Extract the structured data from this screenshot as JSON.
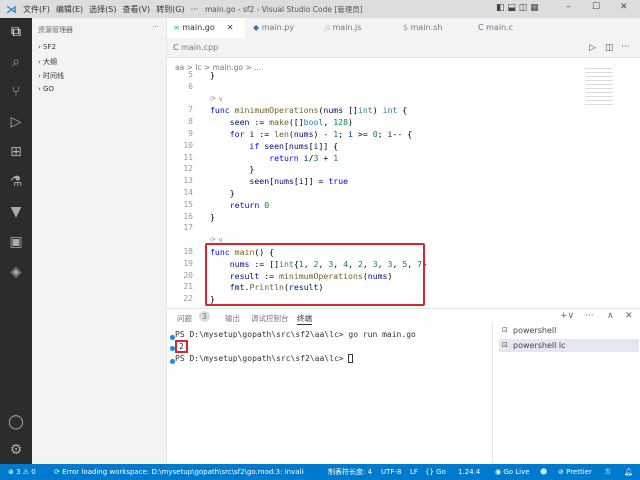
{
  "titlebar": {
    "menus": [
      "文件(F)",
      "编辑(E)",
      "选择(S)",
      "查看(V)",
      "转到(G)",
      "···"
    ],
    "title": "main.go - sf2 - Visual Studio Code [管理员]"
  },
  "sidebar": {
    "header": "资源管理器",
    "more": "···",
    "sections": [
      "SF2",
      "大纲",
      "时间线",
      "GO"
    ]
  },
  "tabs": [
    {
      "label": "main.go",
      "icon": "go-icon",
      "active": true
    },
    {
      "label": "main.py",
      "icon": "python-icon"
    },
    {
      "label": "main.js",
      "icon": "js-icon"
    },
    {
      "label": "main.sh",
      "icon": "shell-icon"
    },
    {
      "label": "main.c",
      "icon": "c-icon"
    },
    {
      "label": "main.cpp",
      "icon": "cpp-icon"
    }
  ],
  "breadcrumb": "aa > lc > main.go > ...",
  "editor": {
    "codelens": "⟳ ∨",
    "lines": [
      {
        "n": "5",
        "t": [
          [
            "}",
            "pl"
          ]
        ]
      },
      {
        "n": "6",
        "t": []
      },
      {
        "lens": true
      },
      {
        "n": "7",
        "t": [
          [
            "func ",
            "kw"
          ],
          [
            "minimumOperations",
            "fn"
          ],
          [
            "(",
            "pl"
          ],
          [
            "nums ",
            "vr"
          ],
          [
            "[]",
            "pl"
          ],
          [
            "int",
            "ty"
          ],
          [
            ") ",
            "pl"
          ],
          [
            "int",
            "ty"
          ],
          [
            " {",
            "pl"
          ]
        ]
      },
      {
        "n": "8",
        "t": [
          [
            "    seen",
            "vr"
          ],
          [
            " := ",
            "pl"
          ],
          [
            "make",
            "fn"
          ],
          [
            "([]",
            "pl"
          ],
          [
            "bool",
            "ty"
          ],
          [
            ", ",
            "pl"
          ],
          [
            "128",
            "nm"
          ],
          [
            ")",
            "pl"
          ]
        ]
      },
      {
        "n": "9",
        "t": [
          [
            "    for ",
            "kw"
          ],
          [
            "i",
            "vr"
          ],
          [
            " := ",
            "pl"
          ],
          [
            "len",
            "fn"
          ],
          [
            "(",
            "pl"
          ],
          [
            "nums",
            "vr"
          ],
          [
            ") - ",
            "pl"
          ],
          [
            "1",
            "nm"
          ],
          [
            "; ",
            "pl"
          ],
          [
            "i",
            "vr"
          ],
          [
            " >= ",
            "pl"
          ],
          [
            "0",
            "nm"
          ],
          [
            "; ",
            "pl"
          ],
          [
            "i",
            "vr"
          ],
          [
            "-- {",
            "pl"
          ]
        ]
      },
      {
        "n": "10",
        "t": [
          [
            "        if ",
            "kw"
          ],
          [
            "seen",
            "vr"
          ],
          [
            "[",
            "pl"
          ],
          [
            "nums",
            "vr"
          ],
          [
            "[",
            "pl"
          ],
          [
            "i",
            "vr"
          ],
          [
            "]] {",
            "pl"
          ]
        ]
      },
      {
        "n": "11",
        "t": [
          [
            "            return ",
            "kw"
          ],
          [
            "i",
            "vr"
          ],
          [
            "/",
            "pl"
          ],
          [
            "3",
            "nm"
          ],
          [
            " + ",
            "pl"
          ],
          [
            "1",
            "nm"
          ]
        ]
      },
      {
        "n": "12",
        "t": [
          [
            "        }",
            "pl"
          ]
        ]
      },
      {
        "n": "13",
        "t": [
          [
            "        seen",
            "vr"
          ],
          [
            "[",
            "pl"
          ],
          [
            "nums",
            "vr"
          ],
          [
            "[",
            "pl"
          ],
          [
            "i",
            "vr"
          ],
          [
            "]] = ",
            "pl"
          ],
          [
            "true",
            "kw"
          ]
        ]
      },
      {
        "n": "14",
        "t": [
          [
            "    }",
            "pl"
          ]
        ]
      },
      {
        "n": "15",
        "t": [
          [
            "    return ",
            "kw"
          ],
          [
            "0",
            "nm"
          ]
        ]
      },
      {
        "n": "16",
        "t": [
          [
            "}",
            "pl"
          ]
        ]
      },
      {
        "n": "17",
        "t": []
      },
      {
        "lens": true
      },
      {
        "n": "18",
        "t": [
          [
            "func ",
            "kw"
          ],
          [
            "main",
            "fn"
          ],
          [
            "() {",
            "pl"
          ]
        ]
      },
      {
        "n": "19",
        "t": [
          [
            "    nums",
            "vr"
          ],
          [
            " := []",
            "pl"
          ],
          [
            "int",
            "ty"
          ],
          [
            "{",
            "pl"
          ],
          [
            "1",
            "nm"
          ],
          [
            ", ",
            "pl"
          ],
          [
            "2",
            "nm"
          ],
          [
            ", ",
            "pl"
          ],
          [
            "3",
            "nm"
          ],
          [
            ", ",
            "pl"
          ],
          [
            "4",
            "nm"
          ],
          [
            ", ",
            "pl"
          ],
          [
            "2",
            "nm"
          ],
          [
            ", ",
            "pl"
          ],
          [
            "3",
            "nm"
          ],
          [
            ", ",
            "pl"
          ],
          [
            "3",
            "nm"
          ],
          [
            ", ",
            "pl"
          ],
          [
            "5",
            "nm"
          ],
          [
            ", ",
            "pl"
          ],
          [
            "7",
            "nm"
          ],
          [
            "}",
            "pl"
          ]
        ]
      },
      {
        "n": "20",
        "t": [
          [
            "    result",
            "vr"
          ],
          [
            " := ",
            "pl"
          ],
          [
            "minimumOperations",
            "fn"
          ],
          [
            "(",
            "pl"
          ],
          [
            "nums",
            "vr"
          ],
          [
            ")",
            "pl"
          ]
        ]
      },
      {
        "n": "21",
        "t": [
          [
            "    fmt",
            "vr"
          ],
          [
            ".",
            "pl"
          ],
          [
            "Println",
            "fn"
          ],
          [
            "(",
            "pl"
          ],
          [
            "result",
            "vr"
          ],
          [
            ")",
            "pl"
          ]
        ]
      },
      {
        "n": "22",
        "t": [
          [
            "}",
            "pl"
          ]
        ]
      }
    ]
  },
  "panel": {
    "tabs": [
      "问题",
      "输出",
      "调试控制台",
      "终端"
    ],
    "problems_count": "3",
    "active_tab": "终端",
    "terminal": [
      "PS D:\\mysetup\\gopath\\src\\sf2\\aa\\lc> go run main.go",
      "2",
      "PS D:\\mysetup\\gopath\\src\\sf2\\aa\\lc> "
    ],
    "terminals": [
      "powershell",
      "powershell lc"
    ]
  },
  "statusbar": {
    "errors": "3",
    "warnings": "0",
    "message": "Error loading workspace: D:\\mysetup\\gopath\\src\\sf2\\go.mod:3: invalid g",
    "indent": "制表符长度: 4",
    "encoding": "UTF-8",
    "eol": "LF",
    "language": "Go",
    "go_version": "1.24.4",
    "golive": "Go Live",
    "prettier": "Prettier"
  },
  "colors": {
    "accent": "#007acc",
    "highlight": "#d9262c"
  }
}
